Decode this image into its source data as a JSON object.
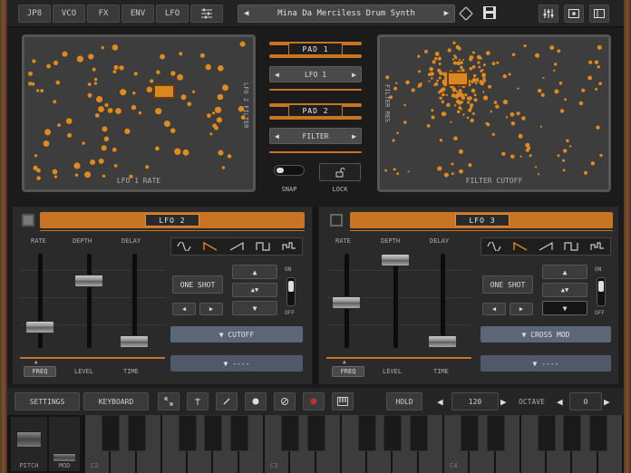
{
  "topbar": {
    "tabs": [
      "JP8",
      "VCO",
      "FX",
      "ENV",
      "LFO"
    ],
    "preset_name": "Mina Da Merciless Drum Synth"
  },
  "pads": {
    "left_x_label": "LFO 1 RATE",
    "left_y_label": "LFO 2 FILTER",
    "right_x_label": "FILTER CUTOFF",
    "right_y_label": "FILTER RES",
    "pad1_title": "PAD 1",
    "pad1_value": "LFO 1",
    "pad2_title": "PAD 2",
    "pad2_value": "FILTER",
    "snap_label": "SNAP",
    "lock_label": "LOCK"
  },
  "lfo2": {
    "title": "LFO 2",
    "rate_label": "RATE",
    "depth_label": "DEPTH",
    "delay_label": "DELAY",
    "freq_label": "FREQ",
    "level_label": "LEVEL",
    "time_label": "TIME",
    "one_shot_label": "ONE SHOT",
    "on_label": "ON",
    "off_label": "OFF",
    "dest1": "CUTOFF",
    "dest2": "----",
    "rate_level": 0.18,
    "depth_level": 0.75,
    "delay_level": 0.0
  },
  "lfo3": {
    "title": "LFO 3",
    "rate_label": "RATE",
    "depth_label": "DEPTH",
    "delay_label": "DELAY",
    "freq_label": "FREQ",
    "level_label": "LEVEL",
    "time_label": "TIME",
    "one_shot_label": "ONE SHOT",
    "on_label": "ON",
    "off_label": "OFF",
    "dest1": "CROSS MOD",
    "dest2": "----",
    "rate_level": 0.48,
    "depth_level": 1.0,
    "delay_level": 0.0
  },
  "bottom": {
    "settings_label": "SETTINGS",
    "keyboard_label": "KEYBOARD",
    "hold_label": "HOLD",
    "tempo_value": "120",
    "octave_label": "OCTAVE",
    "octave_value": "0",
    "pitch_label": "PITCH",
    "mod_label": "MOD"
  },
  "keyboard": {
    "c_labels": [
      "C2",
      "C3",
      "C4"
    ]
  },
  "colors": {
    "accent": "#c87422",
    "dot": "#e08a1e",
    "dest_blue": "#5b6677"
  }
}
